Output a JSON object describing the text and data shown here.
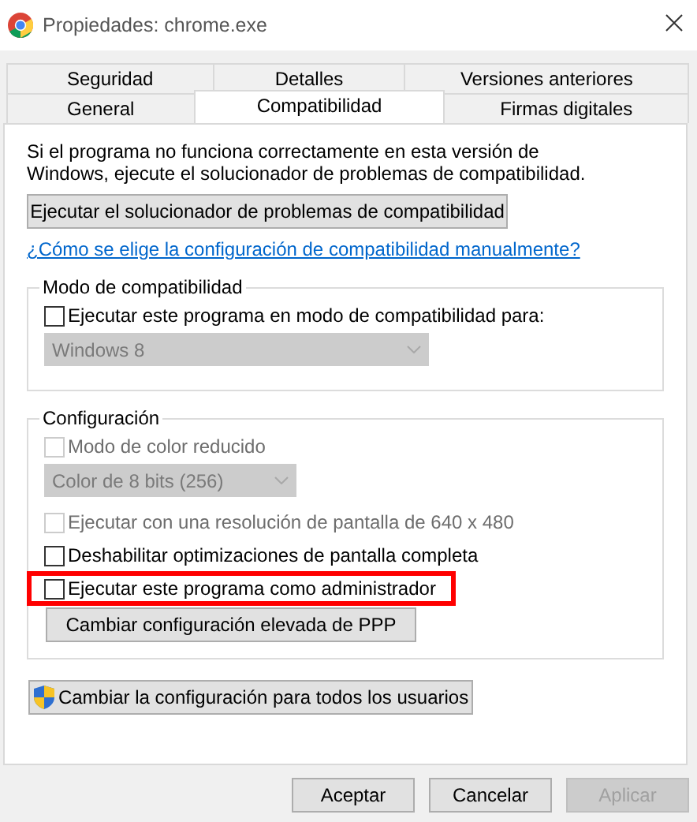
{
  "window": {
    "title": "Propiedades: chrome.exe"
  },
  "tab_rows": [
    {
      "tabs": [
        {
          "label": "Seguridad",
          "selected": false
        },
        {
          "label": "Detalles",
          "selected": false
        },
        {
          "label": "Versiones anteriores",
          "selected": false
        }
      ]
    },
    {
      "tabs": [
        {
          "label": "General",
          "selected": false
        },
        {
          "label": "Compatibilidad",
          "selected": true
        },
        {
          "label": "Firmas digitales",
          "selected": false
        }
      ]
    }
  ],
  "intro": "Si el programa no funciona correctamente en esta versión de Windows, ejecute el solucionador de problemas de compatibilidad.",
  "troubleshoot_button": {
    "label": "Ejecutar el solucionador de problemas de compatibilidad",
    "disabled": false
  },
  "help_link": "¿Cómo se elige la configuración de compatibilidad manualmente?",
  "groups": [
    {
      "title": "Modo de compatibilidad",
      "items": [
        {
          "kind": "checkbox",
          "label": "Ejecutar este programa en modo de compatibilidad para:",
          "checked": false,
          "disabled": false,
          "highlighted": false
        },
        {
          "kind": "dropdown",
          "value": "Windows 8",
          "disabled": true
        }
      ]
    },
    {
      "title": "Configuración",
      "items": [
        {
          "kind": "checkbox",
          "label": "Modo de color reducido",
          "checked": false,
          "disabled": true,
          "highlighted": false
        },
        {
          "kind": "dropdown",
          "value": "Color de 8 bits (256)",
          "disabled": true
        },
        {
          "kind": "checkbox",
          "label": "Ejecutar con una resolución de pantalla de 640 x 480",
          "checked": false,
          "disabled": true,
          "highlighted": false
        },
        {
          "kind": "checkbox",
          "label": "Deshabilitar optimizaciones de pantalla completa",
          "checked": false,
          "disabled": false,
          "highlighted": false
        },
        {
          "kind": "checkbox",
          "label": "Ejecutar este programa como administrador",
          "checked": false,
          "disabled": false,
          "highlighted": true
        },
        {
          "kind": "button",
          "label": "Cambiar configuración elevada de PPP",
          "disabled": false
        }
      ]
    }
  ],
  "all_users_button": {
    "label": "Cambiar la configuración para todos los usuarios",
    "disabled": false
  },
  "buttons": [
    {
      "label": "Aceptar",
      "disabled": false
    },
    {
      "label": "Cancelar",
      "disabled": false
    },
    {
      "label": "Aplicar",
      "disabled": true
    }
  ]
}
